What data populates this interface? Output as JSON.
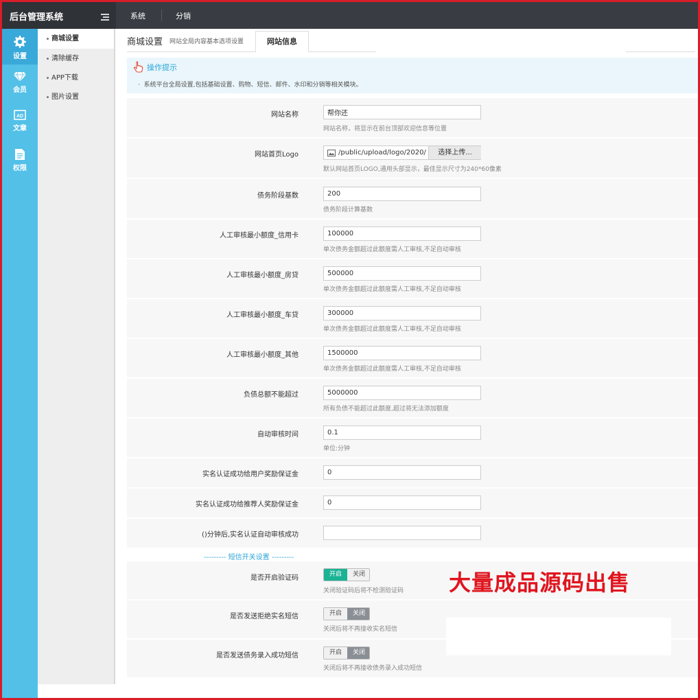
{
  "app": {
    "title": "后台管理系统"
  },
  "topnav": [
    {
      "label": "系统"
    },
    {
      "label": "分销"
    }
  ],
  "iconbar": [
    {
      "label": "设置",
      "icon": "gear-icon",
      "active": true
    },
    {
      "label": "会员",
      "icon": "diamond-icon",
      "active": false
    },
    {
      "label": "文章",
      "icon": "ad-icon",
      "active": false
    },
    {
      "label": "权限",
      "icon": "document-icon",
      "active": false
    }
  ],
  "subnav": [
    {
      "label": "商城设置",
      "active": true
    },
    {
      "label": "清除缓存",
      "active": false
    },
    {
      "label": "APP下载",
      "active": false
    },
    {
      "label": "图片设置",
      "active": false
    }
  ],
  "header": {
    "title": "商城设置",
    "subtitle": "网站全局内容基本选项设置",
    "tab": "网站信息"
  },
  "tip": {
    "title": "操作提示",
    "text": "系统平台全局设置,包括基础设置、购物、短信、邮件、水印和分销等相关模块。"
  },
  "form": {
    "site_name": {
      "label": "网站名称",
      "value": "帮你还",
      "hint": "网站名称，将显示在前台顶部欢迎信息等位置"
    },
    "logo": {
      "label": "网站首页Logo",
      "value": "/public/upload/logo/2020/0",
      "button": "选择上传...",
      "hint": "默认网站首页LOGO,通用头部显示，最佳显示尺寸为240*60像素"
    },
    "debt_stage": {
      "label": "债务阶段基数",
      "value": "200",
      "hint": "债务阶段计算基数"
    },
    "min_credit": {
      "label": "人工审核最小额度_信用卡",
      "value": "100000",
      "hint": "单次债务金额超过此额度需人工审核,不足自动审核"
    },
    "min_house": {
      "label": "人工审核最小额度_房贷",
      "value": "500000",
      "hint": "单次债务金额超过此额度需人工审核,不足自动审核"
    },
    "min_car": {
      "label": "人工审核最小额度_车贷",
      "value": "300000",
      "hint": "单次债务金额超过此额度需人工审核,不足自动审核"
    },
    "min_other": {
      "label": "人工审核最小额度_其他",
      "value": "1500000",
      "hint": "单次债务金额超过此额度需人工审核,不足自动审核"
    },
    "total_debt": {
      "label": "负债总额不能超过",
      "value": "5000000",
      "hint": "所有负债不能超过此额度,超过将无法添加额度"
    },
    "auto_time": {
      "label": "自动审核时间",
      "value": "0.1",
      "hint": "单位:分钟"
    },
    "user_bonus": {
      "label": "实名认证成功给用户奖励保证金",
      "value": "0"
    },
    "ref_bonus": {
      "label": "实名认证成功给推荐人奖励保证金",
      "value": "0"
    },
    "auto_minutes": {
      "label": "()分钟后,实名认证自动审核成功",
      "value": ""
    }
  },
  "sms_section": "--------- 短信开关设置 ---------",
  "switches": [
    {
      "label": "是否开启验证码",
      "on": "开启",
      "off": "关闭",
      "state": "on",
      "hint": "关闭验证码后将不检测验证码"
    },
    {
      "label": "是否发送拒绝实名短信",
      "on": "开启",
      "off": "关闭",
      "state": "off",
      "hint": "关闭后将不再接收实名短信"
    },
    {
      "label": "是否发送债务录入成功短信",
      "on": "开启",
      "off": "关闭",
      "state": "off",
      "hint": "关闭后将不再接收债务录入成功短信"
    }
  ],
  "promo": "大量成品源码出售",
  "colors": {
    "accent": "#2ba5d8",
    "sidebar": "#53c0e8",
    "switch_on": "#1ab394",
    "promo": "#e0141e"
  }
}
